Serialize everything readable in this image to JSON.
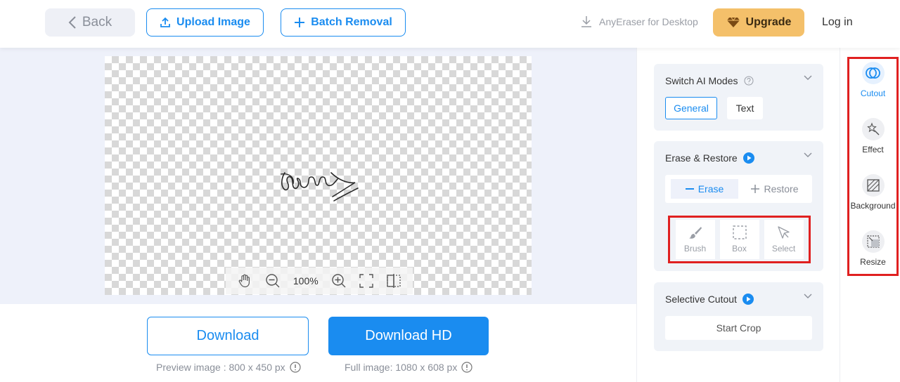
{
  "header": {
    "back_label": "Back",
    "upload_label": "Upload Image",
    "batch_label": "Batch Removal",
    "desktop_label": "AnyEraser for Desktop",
    "upgrade_label": "Upgrade",
    "login_label": "Log in"
  },
  "canvas": {
    "zoom_value": "100%"
  },
  "downloads": {
    "download_label": "Download",
    "download_hd_label": "Download HD",
    "preview_info": "Preview image : 800 x 450 px",
    "full_info": "Full image: 1080 x 608 px"
  },
  "panel": {
    "modes": {
      "title": "Switch AI Modes",
      "general_label": "General",
      "text_label": "Text",
      "selected": "General"
    },
    "erase_restore": {
      "title": "Erase & Restore",
      "erase_label": "Erase",
      "restore_label": "Restore",
      "tools": [
        {
          "label": "Brush",
          "icon": "brush-icon"
        },
        {
          "label": "Box",
          "icon": "box-select-icon"
        },
        {
          "label": "Select",
          "icon": "cursor-icon"
        }
      ]
    },
    "selective": {
      "title": "Selective Cutout",
      "start_crop_label": "Start Crop"
    }
  },
  "side_nav": {
    "items": [
      {
        "label": "Cutout",
        "icon": "cutout-icon",
        "active": true
      },
      {
        "label": "Effect",
        "icon": "magic-wand-icon",
        "active": false
      },
      {
        "label": "Background",
        "icon": "background-icon",
        "active": false
      },
      {
        "label": "Resize",
        "icon": "resize-icon",
        "active": false
      }
    ]
  },
  "colors": {
    "accent": "#1a8cf0",
    "upgrade": "#f4c06a",
    "highlight_border": "#e02020"
  }
}
